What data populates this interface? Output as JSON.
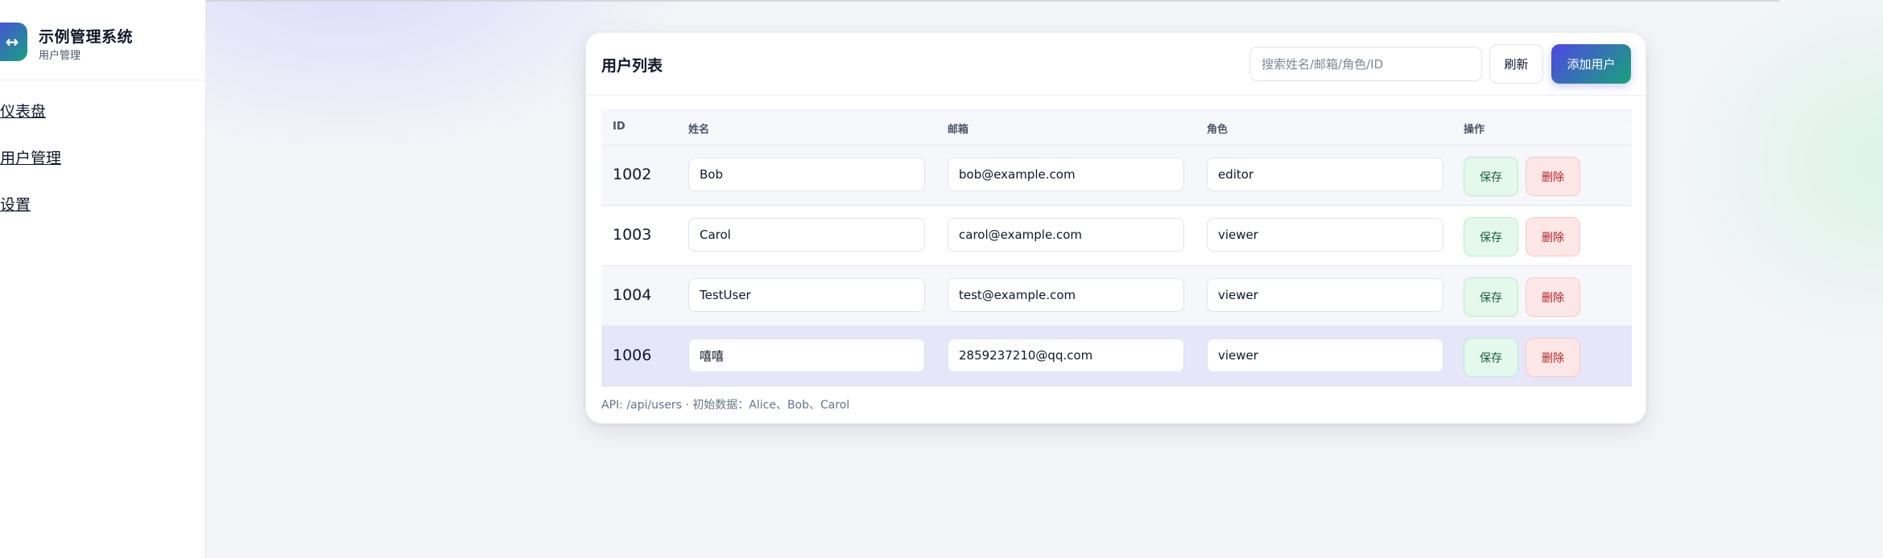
{
  "brand": {
    "logo_icon": "↔",
    "title": "示例管理系统",
    "subtitle": "用户管理"
  },
  "nav": {
    "items": [
      {
        "label": "仪表盘"
      },
      {
        "label": "用户管理"
      },
      {
        "label": "设置"
      }
    ]
  },
  "card": {
    "title": "用户列表",
    "search_placeholder": "搜索姓名/邮箱/角色/ID",
    "search_value": "",
    "refresh_label": "刷新",
    "add_label": "添加用户",
    "columns": [
      "ID",
      "姓名",
      "邮箱",
      "角色",
      "操作"
    ],
    "rows": [
      {
        "id": "1002",
        "name": "Bob",
        "email": "bob@example.com",
        "role": "editor",
        "save": "保存",
        "delete": "删除"
      },
      {
        "id": "1003",
        "name": "Carol",
        "email": "carol@example.com",
        "role": "viewer",
        "save": "保存",
        "delete": "删除"
      },
      {
        "id": "1004",
        "name": "TestUser",
        "email": "test@example.com",
        "role": "viewer",
        "save": "保存",
        "delete": "删除"
      },
      {
        "id": "1006",
        "name": "嘻嘻",
        "email": "2859237210@qq.com",
        "role": "viewer",
        "save": "保存",
        "delete": "删除"
      }
    ],
    "footnote": "API: /api/users · 初始数据：Alice、Bob、Carol"
  },
  "colors": {
    "accent_start": "#4f46e5",
    "accent_end": "#17a47a",
    "save_bg": "#e4f8ec",
    "delete_bg": "#fde6e6",
    "highlight_row": "#e6e6fb"
  }
}
